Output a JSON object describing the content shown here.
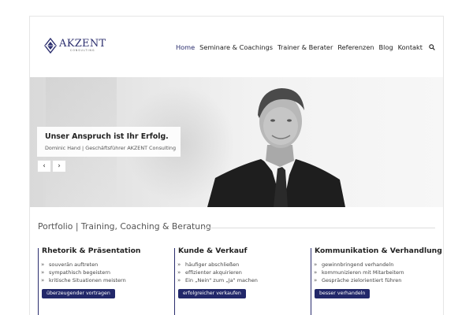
{
  "brand": {
    "name": "AKZENT",
    "subtitle": "CONSULTING",
    "color": "#2b2e6e"
  },
  "nav": {
    "items": [
      {
        "label": "Home",
        "active": true
      },
      {
        "label": "Seminare & Coachings",
        "active": false
      },
      {
        "label": "Trainer & Berater",
        "active": false
      },
      {
        "label": "Referenzen",
        "active": false
      },
      {
        "label": "Blog",
        "active": false
      },
      {
        "label": "Kontakt",
        "active": false
      }
    ],
    "search_icon": "search-icon"
  },
  "hero": {
    "title": "Unser Anspruch ist Ihr Erfolg.",
    "subtitle": "Dominic Hand | Geschäftsführer AKZENT Consulting",
    "prev": "‹",
    "next": "›"
  },
  "portfolio": {
    "title": "Portfolio | Training, Coaching & Beratung",
    "columns": [
      {
        "title": "Rhetorik & Präsentation",
        "items": [
          "souverän auftreten",
          "sympathisch begeistern",
          "kritische Situationen meistern"
        ],
        "button": "überzeugender vortragen"
      },
      {
        "title": "Kunde & Verkauf",
        "items": [
          "häufiger abschließen",
          "effizienter akquirieren",
          "Ein „Nein\" zum „Ja\" machen"
        ],
        "button": "erfolgreicher verkaufen"
      },
      {
        "title": "Kommunikation & Verhandlung",
        "items": [
          "gewinnbringend verhandeln",
          "kommunizieren mit Mitarbeitern",
          "Gespräche zielorientiert führen"
        ],
        "button": "besser verhandeln"
      }
    ]
  }
}
